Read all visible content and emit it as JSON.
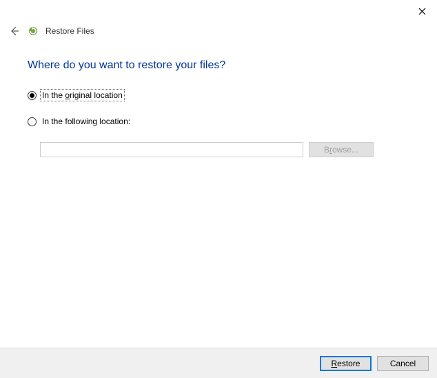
{
  "header": {
    "title": "Restore Files"
  },
  "heading": "Where do you want to restore your files?",
  "options": {
    "original": "In the original location",
    "following": "In the following location:"
  },
  "pathInput": {
    "value": "",
    "placeholder": ""
  },
  "buttons": {
    "browse": "Browse...",
    "restore": "Restore",
    "cancel": "Cancel"
  }
}
